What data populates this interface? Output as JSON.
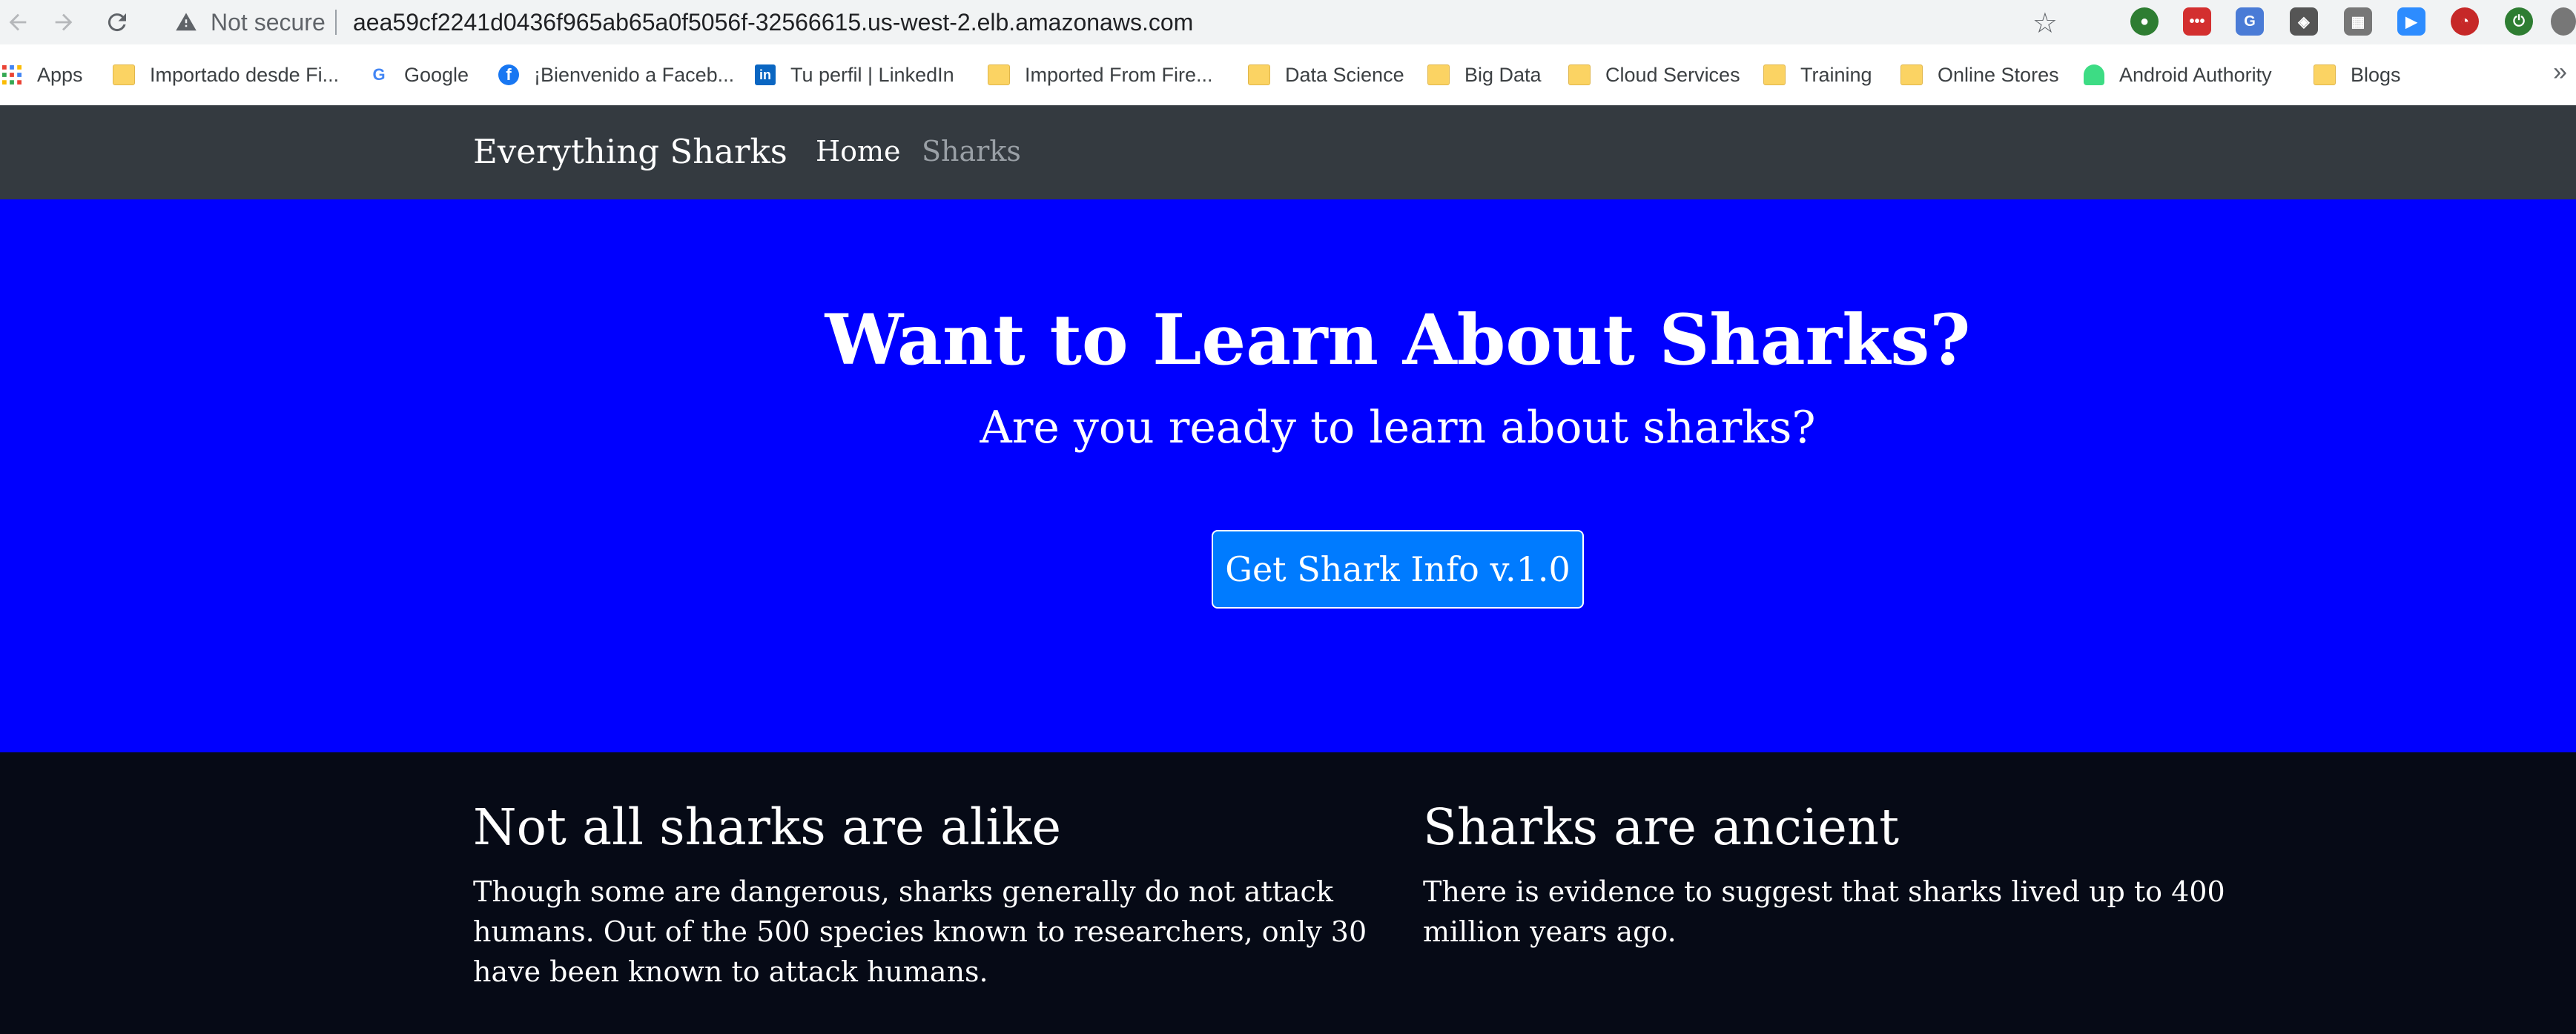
{
  "browser": {
    "security_label": "Not secure",
    "url": "aea59cf2241d0436f965ab65a0f5056f-32566615.us-west-2.elb.amazonaws.com",
    "bookmarks": [
      {
        "label": "Apps",
        "icon": "apps-grid-icon"
      },
      {
        "label": "Importado desde Fi...",
        "icon": "folder-icon"
      },
      {
        "label": "Google",
        "icon": "google-icon"
      },
      {
        "label": "¡Bienvenido a Faceb...",
        "icon": "facebook-icon"
      },
      {
        "label": "Tu perfil | LinkedIn",
        "icon": "linkedin-icon"
      },
      {
        "label": "Imported From Fire...",
        "icon": "folder-icon"
      },
      {
        "label": "Data Science",
        "icon": "folder-icon"
      },
      {
        "label": "Big Data",
        "icon": "folder-icon"
      },
      {
        "label": "Cloud Services",
        "icon": "folder-icon"
      },
      {
        "label": "Training",
        "icon": "folder-icon"
      },
      {
        "label": "Online Stores",
        "icon": "folder-icon"
      },
      {
        "label": "Android Authority",
        "icon": "android-icon"
      },
      {
        "label": "Blogs",
        "icon": "folder-icon"
      }
    ],
    "more_label": "»"
  },
  "site": {
    "brand": "Everything Sharks",
    "nav": {
      "home": "Home",
      "sharks": "Sharks"
    },
    "hero": {
      "title": "Want to Learn About Sharks?",
      "subtitle": "Are you ready to learn about sharks?",
      "button": "Get Shark Info v.1.0"
    },
    "features": [
      {
        "title": "Not all sharks are alike",
        "text": "Though some are dangerous, sharks generally do not attack humans. Out of the 500 species known to researchers, only 30 have been known to attack humans."
      },
      {
        "title": "Sharks are ancient",
        "text": "There is evidence to suggest that sharks lived up to 400 million years ago."
      }
    ]
  },
  "colors": {
    "navbar": "#343a40",
    "hero": "#0000ff",
    "button": "#007bff",
    "footer": "#060a16"
  }
}
